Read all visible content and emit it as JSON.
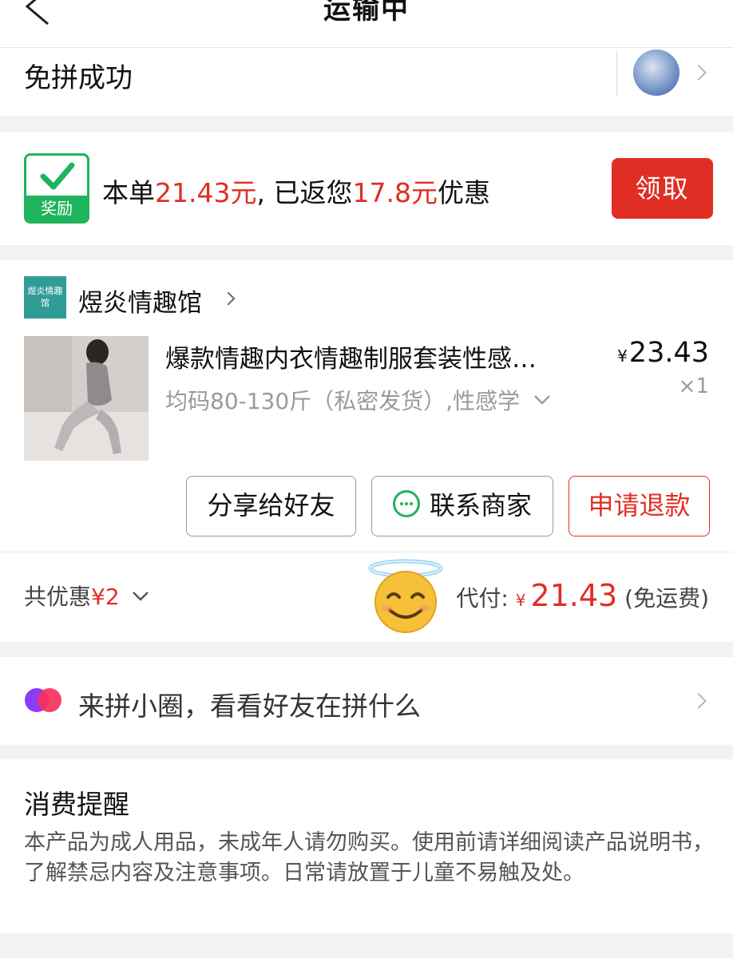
{
  "header": {
    "title": "运输中"
  },
  "group": {
    "status": "免拼成功"
  },
  "reward": {
    "badge_label": "奖励",
    "text_before": "本单",
    "order_amount": "21.43元",
    "text_middle": ", 已返您",
    "returned_amount": "17.8元",
    "text_after": "优惠",
    "claim_label": "领取"
  },
  "order": {
    "shop_name": "煜炎情趣馆",
    "shop_logo_text": "煜炎情趣馆",
    "product_title": "爆款情趣内衣情趣制服套装性感…",
    "product_price_symbol": "¥",
    "product_price": "23.43",
    "product_spec": "均码80-130斤（私密发货）,性感学",
    "product_qty": "×1",
    "share_label": "分享给好友",
    "contact_label": "联系商家",
    "refund_label": "申请退款",
    "discount_label": "共优惠",
    "discount_amount": "¥2",
    "paid_label": "代付:",
    "paid_symbol": "¥",
    "paid_amount": "21.43",
    "shipping_note": "(免运费)"
  },
  "circle": {
    "text": "来拼小圈，看看好友在拼什么"
  },
  "notice": {
    "title": "消费提醒",
    "body": "本产品为成人用品，未成年人请勿购买。使用前请详细阅读产品说明书，了解禁忌内容及注意事项。日常请放置于儿童不易触及处。"
  },
  "colors": {
    "accent_red": "#e02e24",
    "reward_green": "#1fb45b",
    "wechat_green": "#1fb45b"
  },
  "icons": [
    "back-arrow-icon",
    "chevron-right-icon",
    "checkmark-icon",
    "chevron-down-icon",
    "wechat-chat-icon",
    "halo-smile-emoji-icon",
    "circle-overlap-icon"
  ]
}
